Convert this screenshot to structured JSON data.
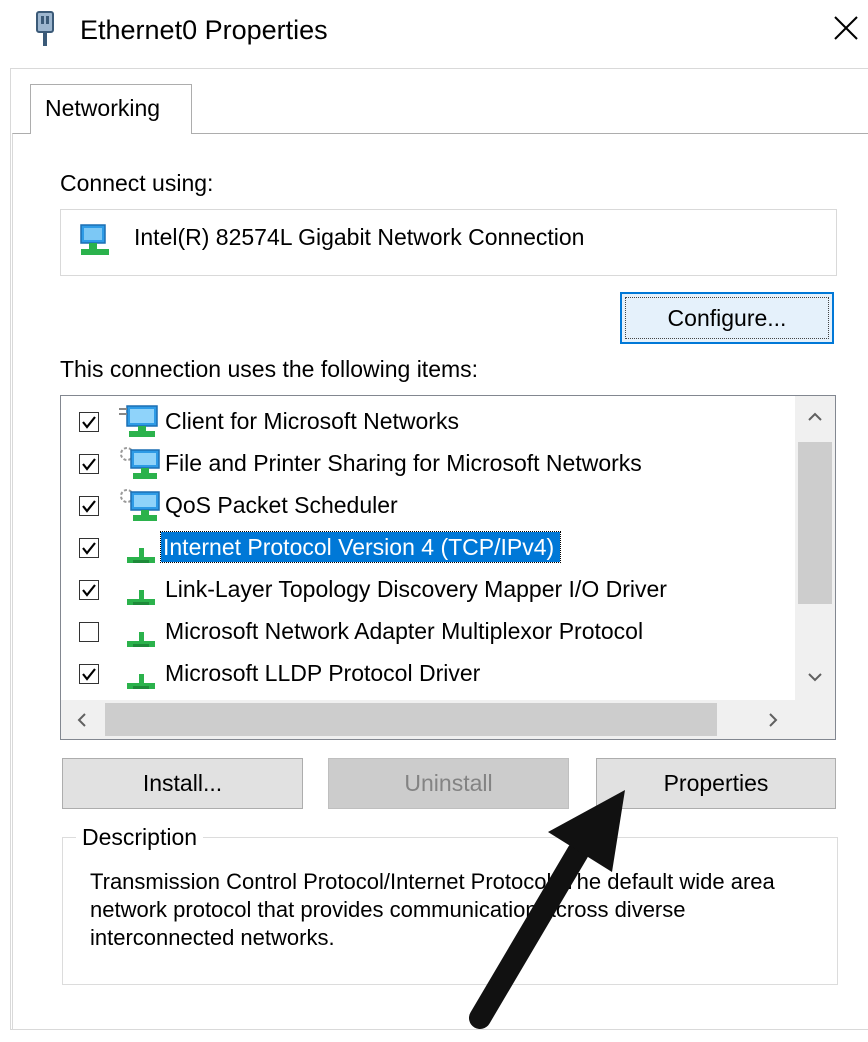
{
  "window": {
    "title": "Ethernet0 Properties",
    "close_glyph": "✕"
  },
  "tabs": [
    {
      "label": "Networking",
      "active": true
    }
  ],
  "connect_using": {
    "label": "Connect using:",
    "adapter": "Intel(R) 82574L Gigabit Network Connection",
    "adapter_icon": "network-adapter-icon"
  },
  "configure_button": "Configure...",
  "items_section": {
    "label": "This connection uses the following items:",
    "items": [
      {
        "label": "Client for Microsoft Networks",
        "checked": true,
        "icon": "network-client-icon",
        "selected": false
      },
      {
        "label": "File and Printer Sharing for Microsoft Networks",
        "checked": true,
        "icon": "network-service-icon",
        "selected": false
      },
      {
        "label": "QoS Packet Scheduler",
        "checked": true,
        "icon": "network-service-icon",
        "selected": false
      },
      {
        "label": "Internet Protocol Version 4 (TCP/IPv4)",
        "checked": true,
        "icon": "protocol-icon",
        "selected": true
      },
      {
        "label": "Link-Layer Topology Discovery Mapper I/O Driver",
        "checked": true,
        "icon": "protocol-icon",
        "selected": false
      },
      {
        "label": "Microsoft Network Adapter Multiplexor Protocol",
        "checked": false,
        "icon": "protocol-icon",
        "selected": false
      },
      {
        "label": "Microsoft LLDP Protocol Driver",
        "checked": true,
        "icon": "protocol-icon",
        "selected": false
      }
    ]
  },
  "buttons": {
    "install": "Install...",
    "uninstall": "Uninstall",
    "properties": "Properties"
  },
  "description": {
    "legend": "Description",
    "text": "Transmission Control Protocol/Internet Protocol. The default wide area network protocol that provides communication across diverse interconnected networks."
  },
  "colors": {
    "selection": "#0078d7",
    "button_face": "#e1e1e1",
    "disabled_text": "#838383",
    "focus_border": "#0078d7"
  }
}
